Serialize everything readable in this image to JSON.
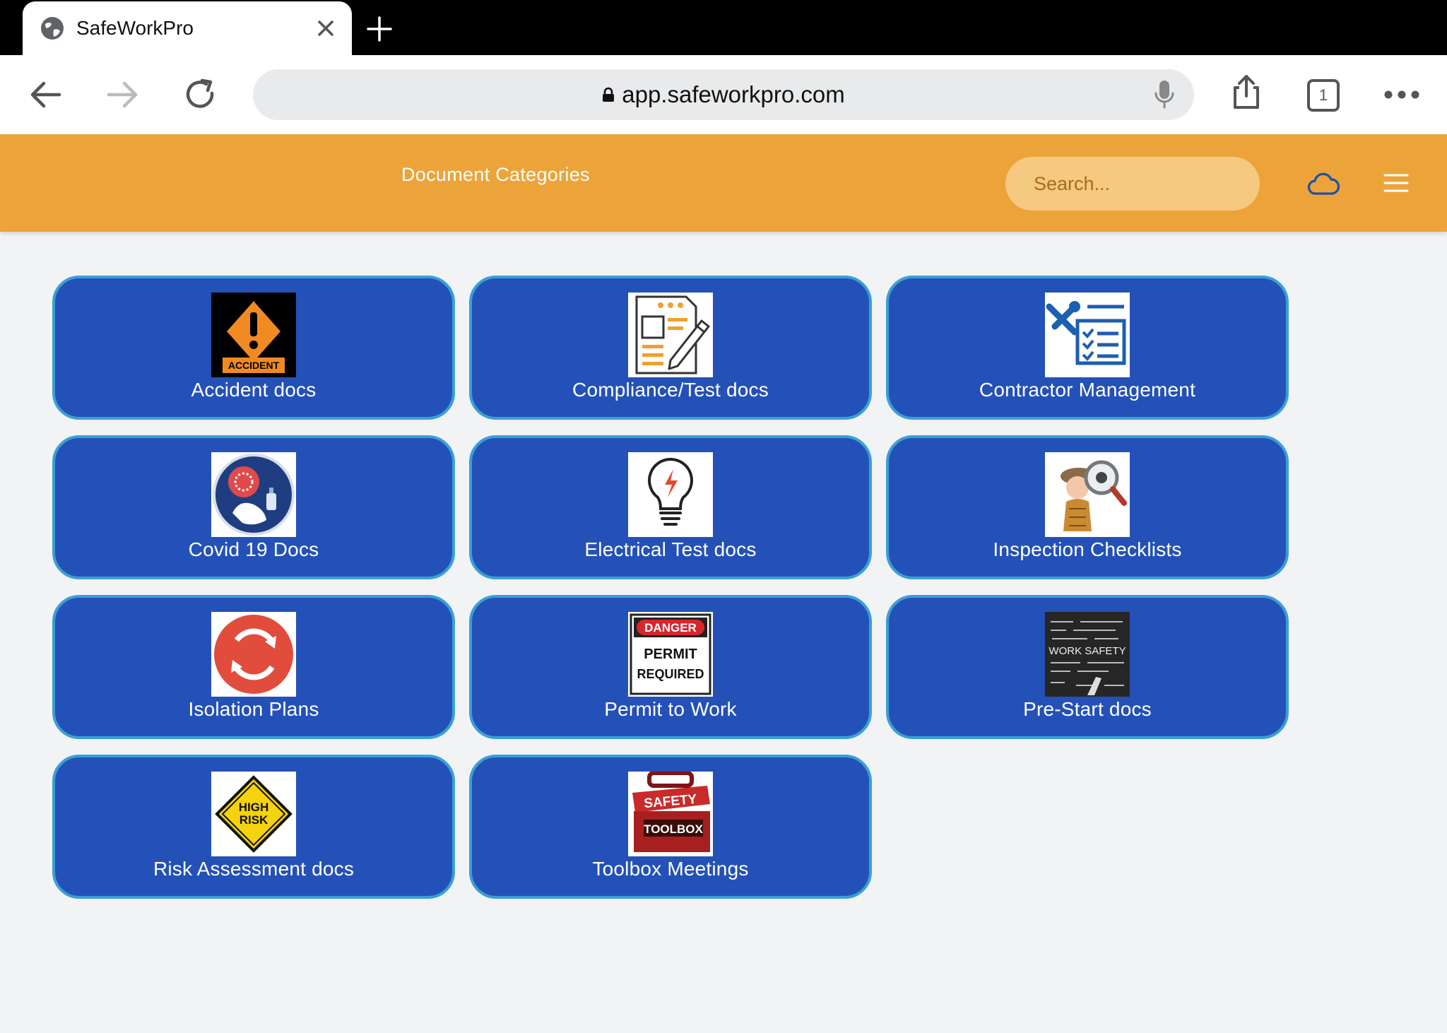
{
  "browser": {
    "tab_title": "SafeWorkPro",
    "url": "app.safeworkpro.com",
    "tabs_count": "1"
  },
  "header": {
    "title": "Document Categories",
    "search_placeholder": "Search..."
  },
  "categories": [
    {
      "label": "Accident docs",
      "icon": "accident-icon",
      "thumb_text": "ACCIDENT"
    },
    {
      "label": "Compliance/Test docs",
      "icon": "document-edit-icon"
    },
    {
      "label": "Contractor Management",
      "icon": "tools-checklist-icon"
    },
    {
      "label": "Covid 19 Docs",
      "icon": "virus-handwash-icon"
    },
    {
      "label": "Electrical Test docs",
      "icon": "lightbulb-bolt-icon"
    },
    {
      "label": "Inspection Checklists",
      "icon": "inspector-magnifier-icon"
    },
    {
      "label": "Isolation Plans",
      "icon": "circular-arrows-icon"
    },
    {
      "label": "Permit to Work",
      "icon": "danger-sign-icon",
      "thumb_text": "DANGER",
      "thumb_text_2": "PERMIT",
      "thumb_text_3": "REQUIRED"
    },
    {
      "label": "Pre-Start docs",
      "icon": "chalkboard-icon",
      "thumb_text": "WORK SAFETY"
    },
    {
      "label": "Risk Assessment docs",
      "icon": "high-risk-sign-icon",
      "thumb_text": "HIGH",
      "thumb_text_2": "RISK"
    },
    {
      "label": "Toolbox Meetings",
      "icon": "safety-toolbox-icon",
      "thumb_text": "SAFETY",
      "thumb_text_2": "TOOLBOX"
    }
  ],
  "colors": {
    "header": "#eca43a",
    "card": "#2451b7",
    "card_border": "#3a9fd6"
  }
}
